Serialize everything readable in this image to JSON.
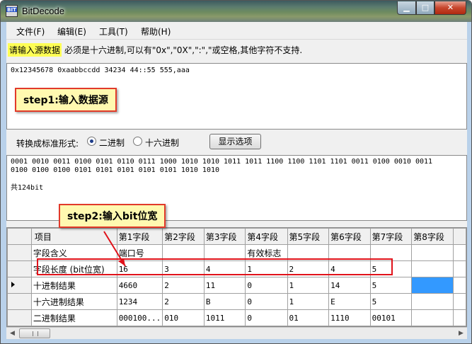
{
  "window": {
    "title": "BitDecode",
    "icon_text": "BIT"
  },
  "menu": [
    "文件(F)",
    "编辑(E)",
    "工具(T)",
    "帮助(H)"
  ],
  "hint": {
    "label": "请输入源数据",
    "text": "必须是十六进制,可以有\"0x\",\"0X\",\":\",\"或空格,其他字符不支持."
  },
  "input": {
    "value": "0x12345678 0xaabbccdd 34234 44::55 555,aaa"
  },
  "callouts": {
    "step1": "step1:输入数据源",
    "step2": "step2:输入bit位宽"
  },
  "convert": {
    "label": "转换成标准形式:",
    "options": [
      {
        "label": "二进制",
        "selected": true
      },
      {
        "label": "十六进制",
        "selected": false
      }
    ],
    "show_button": "显示选项"
  },
  "output": {
    "binary_line1": "0001 0010 0011 0100 0101 0110 0111 1000 1010 1010 1011 1011 1100 1100 1101 1101 0011 0100 0010 0011",
    "binary_line2": "0100 0100 0100 0101 0101 0101 0101 0101 1010 1010",
    "count": "共124bit"
  },
  "grid": {
    "columns": [
      "项目",
      "第1字段",
      "第2字段",
      "第3字段",
      "第4字段",
      "第5字段",
      "第6字段",
      "第7字段",
      "第8字段"
    ],
    "rows": [
      {
        "label": "字段含义",
        "cells": [
          "端口号",
          "",
          "",
          "有效标志",
          "",
          "",
          "",
          ""
        ]
      },
      {
        "label": "字段长度 (bit位宽)",
        "cells": [
          "16",
          "3",
          "4",
          "1",
          "2",
          "4",
          "5",
          ""
        ]
      },
      {
        "label": "十进制结果",
        "cells": [
          "4660",
          "2",
          "11",
          "0",
          "1",
          "14",
          "5",
          ""
        ],
        "current": true
      },
      {
        "label": "十六进制结果",
        "cells": [
          "1234",
          "2",
          "B",
          "0",
          "1",
          "E",
          "5",
          ""
        ]
      },
      {
        "label": "二进制结果",
        "cells": [
          "000100...",
          "010",
          "1011",
          "0",
          "01",
          "1110",
          "00101",
          ""
        ]
      }
    ]
  }
}
